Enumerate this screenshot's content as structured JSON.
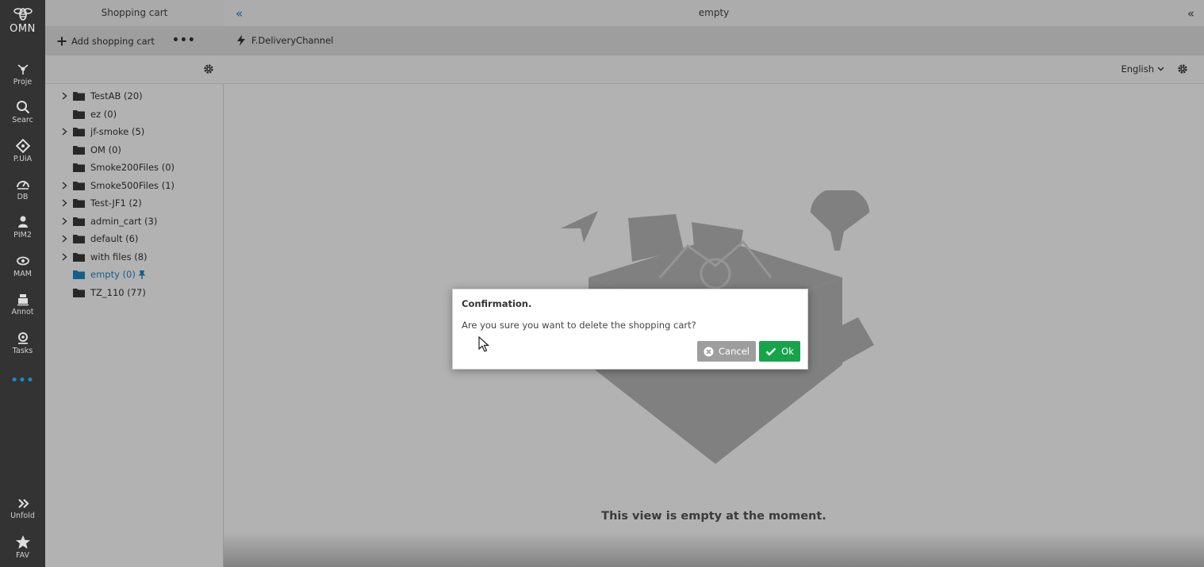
{
  "rail": {
    "logo": "OMN",
    "items": [
      {
        "label": "Proje",
        "icon": "project-icon"
      },
      {
        "label": "Searc",
        "icon": "search-icon"
      },
      {
        "label": "P.UiA",
        "icon": "diamond-icon"
      },
      {
        "label": "DB",
        "icon": "dashboard-icon"
      },
      {
        "label": "PIM2",
        "icon": "pim-icon"
      },
      {
        "label": "MAM",
        "icon": "eye-icon"
      },
      {
        "label": "Annot",
        "icon": "annotation-icon"
      },
      {
        "label": "Tasks",
        "icon": "tasks-icon"
      }
    ],
    "more": "•••",
    "unfold": "Unfold",
    "fav": "FAV"
  },
  "panel": {
    "title": "Shopping cart",
    "add_label": "Add shopping cart",
    "more": "•••",
    "tree": [
      {
        "label": "TestAB (20)",
        "expandable": true
      },
      {
        "label": "ez (0)",
        "expandable": false
      },
      {
        "label": "jf-smoke (5)",
        "expandable": true
      },
      {
        "label": "OM (0)",
        "expandable": false
      },
      {
        "label": "Smoke200Files (0)",
        "expandable": false
      },
      {
        "label": "Smoke500Files (1)",
        "expandable": true
      },
      {
        "label": "Test-JF1 (2)",
        "expandable": true
      },
      {
        "label": "admin_cart (3)",
        "expandable": true
      },
      {
        "label": "default (6)",
        "expandable": true
      },
      {
        "label": "with files (8)",
        "expandable": true
      },
      {
        "label": "empty (0)",
        "expandable": false,
        "active": true,
        "pinned": true
      },
      {
        "label": "TZ_110 (77)",
        "expandable": false
      }
    ]
  },
  "main": {
    "title": "empty",
    "collapse_left": "«",
    "collapse_right": "«",
    "toolbar_label": "F.DeliveryChannel",
    "language": "English",
    "empty_message": "This view is empty at the moment."
  },
  "dialog": {
    "title": "Confirmation.",
    "message": "Are you sure you want to delete the shopping cart?",
    "cancel_label": "Cancel",
    "ok_label": "Ok"
  },
  "colors": {
    "accent": "#1e88c9",
    "ok_green": "#17a34a",
    "cancel_gray": "#9e9e9e",
    "rail_bg": "#333333"
  }
}
